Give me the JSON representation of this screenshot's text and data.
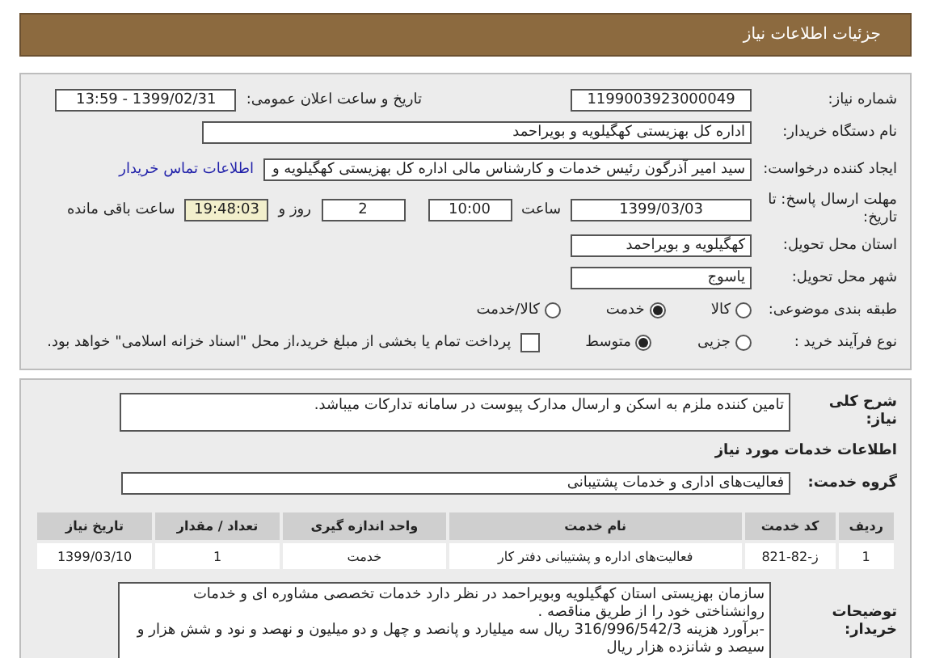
{
  "header": {
    "title": "جزئیات اطلاعات نیاز"
  },
  "need_number": {
    "label": "شماره نیاز:",
    "value": "1199003923000049"
  },
  "announce": {
    "label": "تاریخ و ساعت اعلان عمومی:",
    "value": "1399/02/31 - 13:59"
  },
  "buyer": {
    "label": "نام دستگاه خریدار:",
    "value": "اداره کل بهزیستی کهگیلویه و بویراحمد"
  },
  "creator": {
    "label": "ایجاد کننده درخواست:",
    "value": "سید امیر آذرگون رئیس خدمات و کارشناس مالی اداره کل بهزیستی کهگیلویه و",
    "link": "اطلاعات تماس خریدار"
  },
  "deadline": {
    "label": "مهلت ارسال پاسخ: تا تاریخ:",
    "date": "1399/03/03",
    "time_label": "ساعت",
    "time": "10:00",
    "days": "2",
    "days_label": "روز و",
    "remaining": "19:48:03",
    "remaining_label": "ساعت باقی مانده"
  },
  "province": {
    "label": "استان محل تحویل:",
    "value": "کهگیلویه و بویراحمد"
  },
  "city": {
    "label": "شهر محل تحویل:",
    "value": "یاسوج"
  },
  "category": {
    "label": "طبقه بندی موضوعی:",
    "options": [
      {
        "label": "کالا",
        "selected": false
      },
      {
        "label": "خدمت",
        "selected": true
      },
      {
        "label": "کالا/خدمت",
        "selected": false
      }
    ]
  },
  "purchase": {
    "label": "نوع فرآیند خرید :",
    "options": [
      {
        "label": "جزیی",
        "selected": false
      },
      {
        "label": "متوسط",
        "selected": true
      }
    ],
    "payment": {
      "checked": false,
      "text": "پرداخت تمام یا بخشی از مبلغ خرید،از محل \"اسناد خزانه اسلامی\" خواهد بود."
    }
  },
  "summary": {
    "label": "شرح کلی نیاز:",
    "value": "تامین کننده ملزم به اسکن و ارسال مدارک پیوست در سامانه تدارکات میباشد."
  },
  "services_title": "اطلاعات خدمات مورد نیاز",
  "service_group": {
    "label": "گروه خدمت:",
    "value": "فعالیت‌های اداری و خدمات پشتیبانی"
  },
  "table": {
    "columns": [
      "ردیف",
      "کد خدمت",
      "نام خدمت",
      "واحد اندازه گیری",
      "تعداد / مقدار",
      "تاریخ نیاز"
    ],
    "rows": [
      [
        "1",
        "ز-82-821",
        "فعالیت‌های اداره و پشتیبانی دفتر کار",
        "خدمت",
        "1",
        "1399/03/10"
      ]
    ]
  },
  "notes": {
    "label": "توضیحات خریدار:",
    "lines": [
      "سازمان بهزیستی استان کهگیلویه وبویراحمد در نظر دارد خدمات تخصصی مشاوره ای و خدمات روانشناختی خود را از طریق مناقصه .",
      "-برآورد هزینه 316/996/542/3 ریال سه میلیارد و پانصد و چهل و دو میلیون و نهصد و نود و شش هزار و سیصد و شانزده هزار ریال"
    ]
  }
}
